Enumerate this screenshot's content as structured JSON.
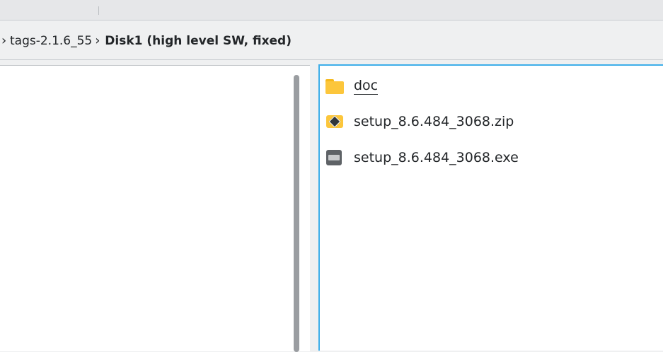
{
  "breadcrumb": {
    "items": [
      {
        "label": "tags-2.1.6_55"
      },
      {
        "label": "Disk1 (high level SW, fixed)"
      }
    ]
  },
  "files": [
    {
      "name": "doc",
      "type": "folder",
      "icon": "folder-icon"
    },
    {
      "name": "setup_8.6.484_3068.zip",
      "type": "zip",
      "icon": "archive-icon"
    },
    {
      "name": "setup_8.6.484_3068.exe",
      "type": "exe",
      "icon": "executable-icon"
    }
  ],
  "colors": {
    "accent": "#3daee9",
    "folder": "#fcc63b",
    "text": "#232629"
  }
}
